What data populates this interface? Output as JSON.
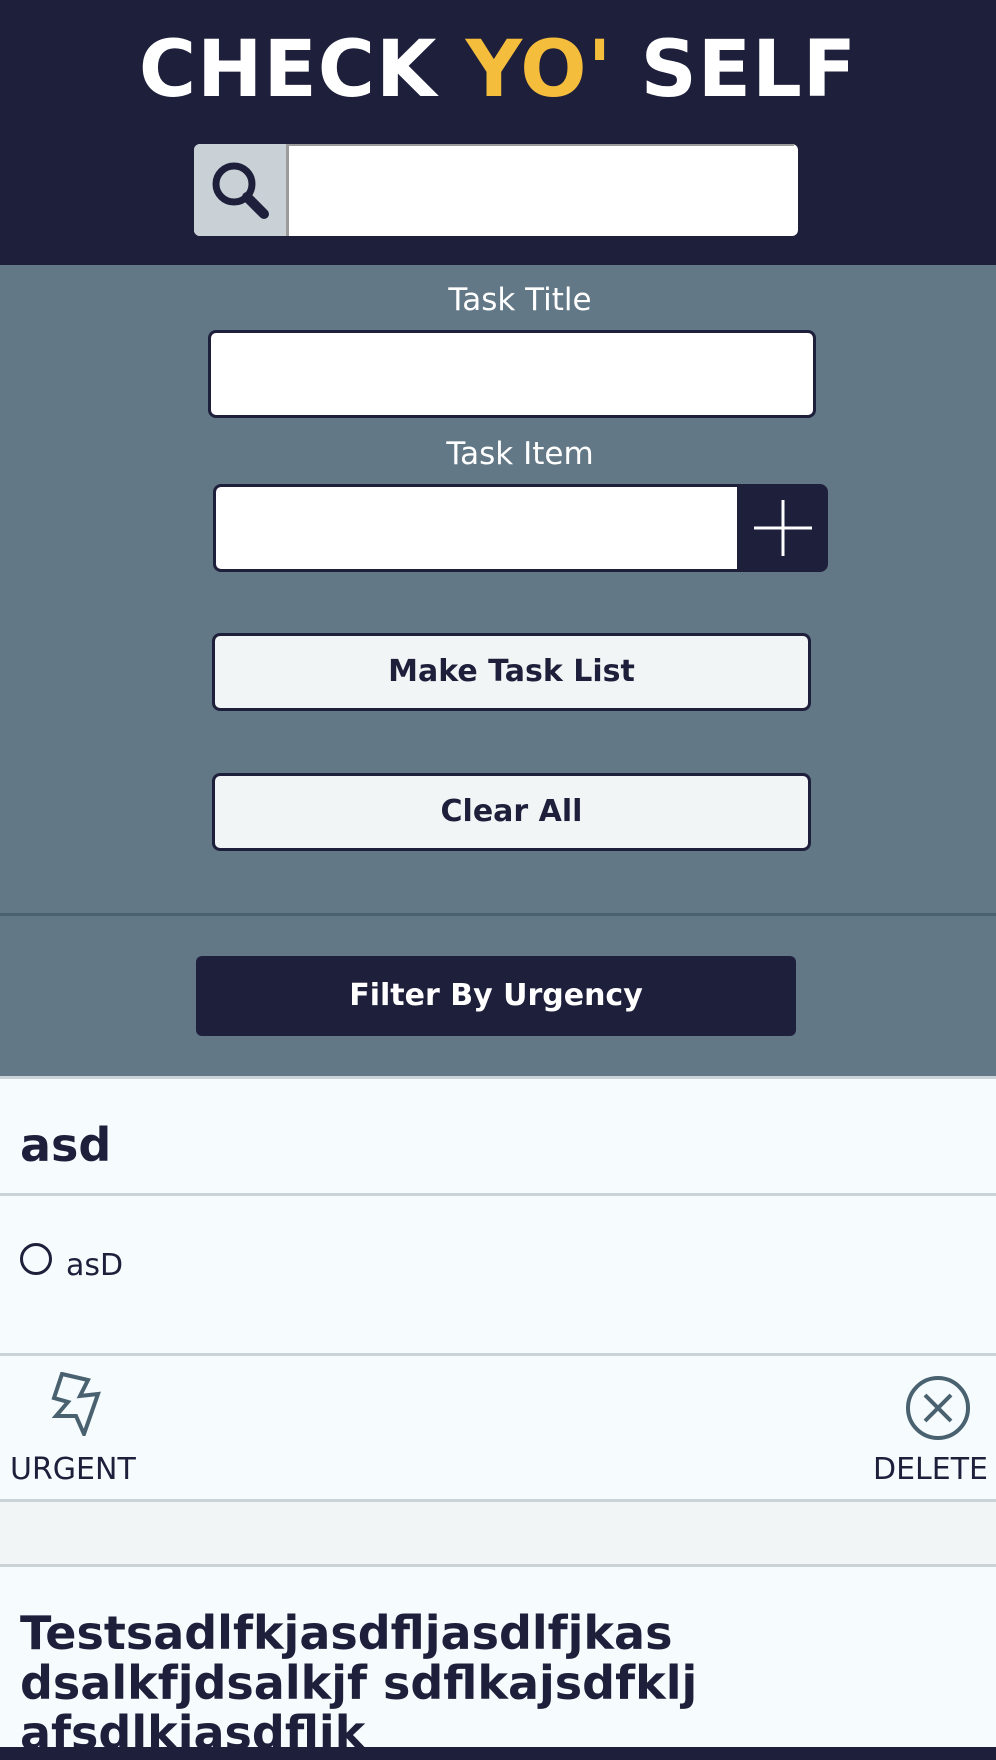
{
  "header": {
    "brand_part1": "CHECK ",
    "brand_part2": "YO'",
    "brand_part3": " SELF",
    "search": {
      "value": "",
      "placeholder": "",
      "icon": "search-icon"
    }
  },
  "form": {
    "task_title_label": "Task Title",
    "task_title_value": "",
    "task_item_label": "Task Item",
    "task_item_value": "",
    "add_icon": "plus-icon",
    "make_list_label": "Make Task List",
    "clear_all_label": "Clear All"
  },
  "filter": {
    "label": "Filter By Urgency"
  },
  "cards": [
    {
      "title": "asd",
      "items": [
        {
          "text": "asD",
          "checked": false
        }
      ],
      "urgent_label": "URGENT",
      "urgent_icon": "lightning-bolt-icon",
      "delete_label": "DELETE",
      "delete_icon": "close-circle-icon"
    },
    {
      "title": "Testsadlfkjasdfljasdlfjkas dsalkfjdsalkjf sdflkajsdfklj afsdlkjasdfljk"
    }
  ],
  "colors": {
    "navy": "#1e1f3b",
    "slate": "#627886",
    "accent_yellow": "#f5bd3c",
    "card_bg": "#f6fbfd",
    "icon_teal": "#4a6270"
  }
}
